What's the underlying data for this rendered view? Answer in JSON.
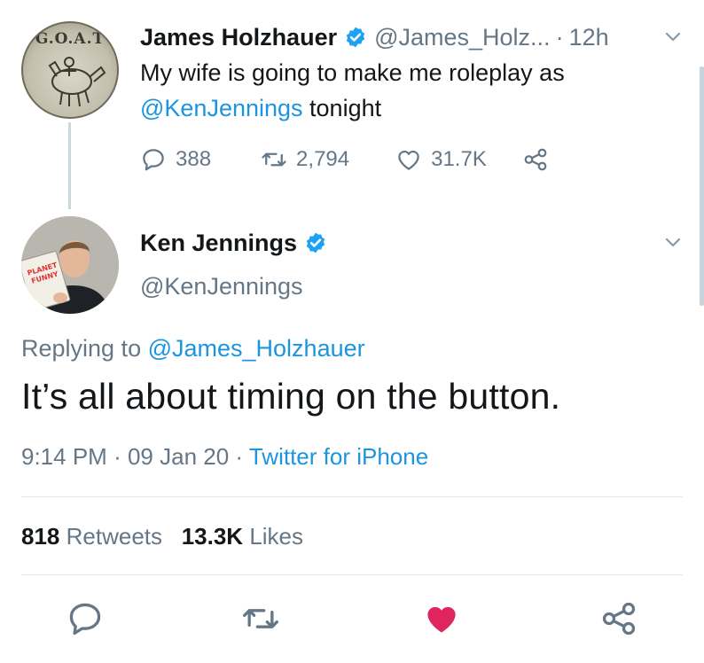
{
  "parent_tweet": {
    "avatar_text": "G.O.A.T",
    "name": "James Holzhauer",
    "handle": "@James_Holz...",
    "separator": "·",
    "time": "12h",
    "text_before": "My wife is going to make me roleplay as",
    "mention": "@KenJennings",
    "text_after": " tonight",
    "replies": "388",
    "retweets": "2,794",
    "likes": "31.7K"
  },
  "main_tweet": {
    "name": "Ken Jennings",
    "handle": "@KenJennings",
    "replying_prefix": "Replying to ",
    "replying_handle": "@James_Holzhauer",
    "text": "It’s all about timing on the button.",
    "time": "9:14 PM",
    "date": "09 Jan 20",
    "separator": "·",
    "source": "Twitter for iPhone",
    "retweets_count": "818",
    "retweets_label": "Retweets",
    "likes_count": "13.3K",
    "likes_label": "Likes",
    "liked": true
  },
  "icons": {
    "verified": "verified-badge-icon",
    "chevron": "chevron-down-icon",
    "reply": "reply-icon",
    "retweet": "retweet-icon",
    "like": "heart-icon",
    "share": "share-icon"
  },
  "colors": {
    "link": "#1b95e0",
    "secondary_text": "#657786",
    "primary_text": "#14171a",
    "liked_heart": "#e0245e",
    "verified": "#1da1f2"
  }
}
